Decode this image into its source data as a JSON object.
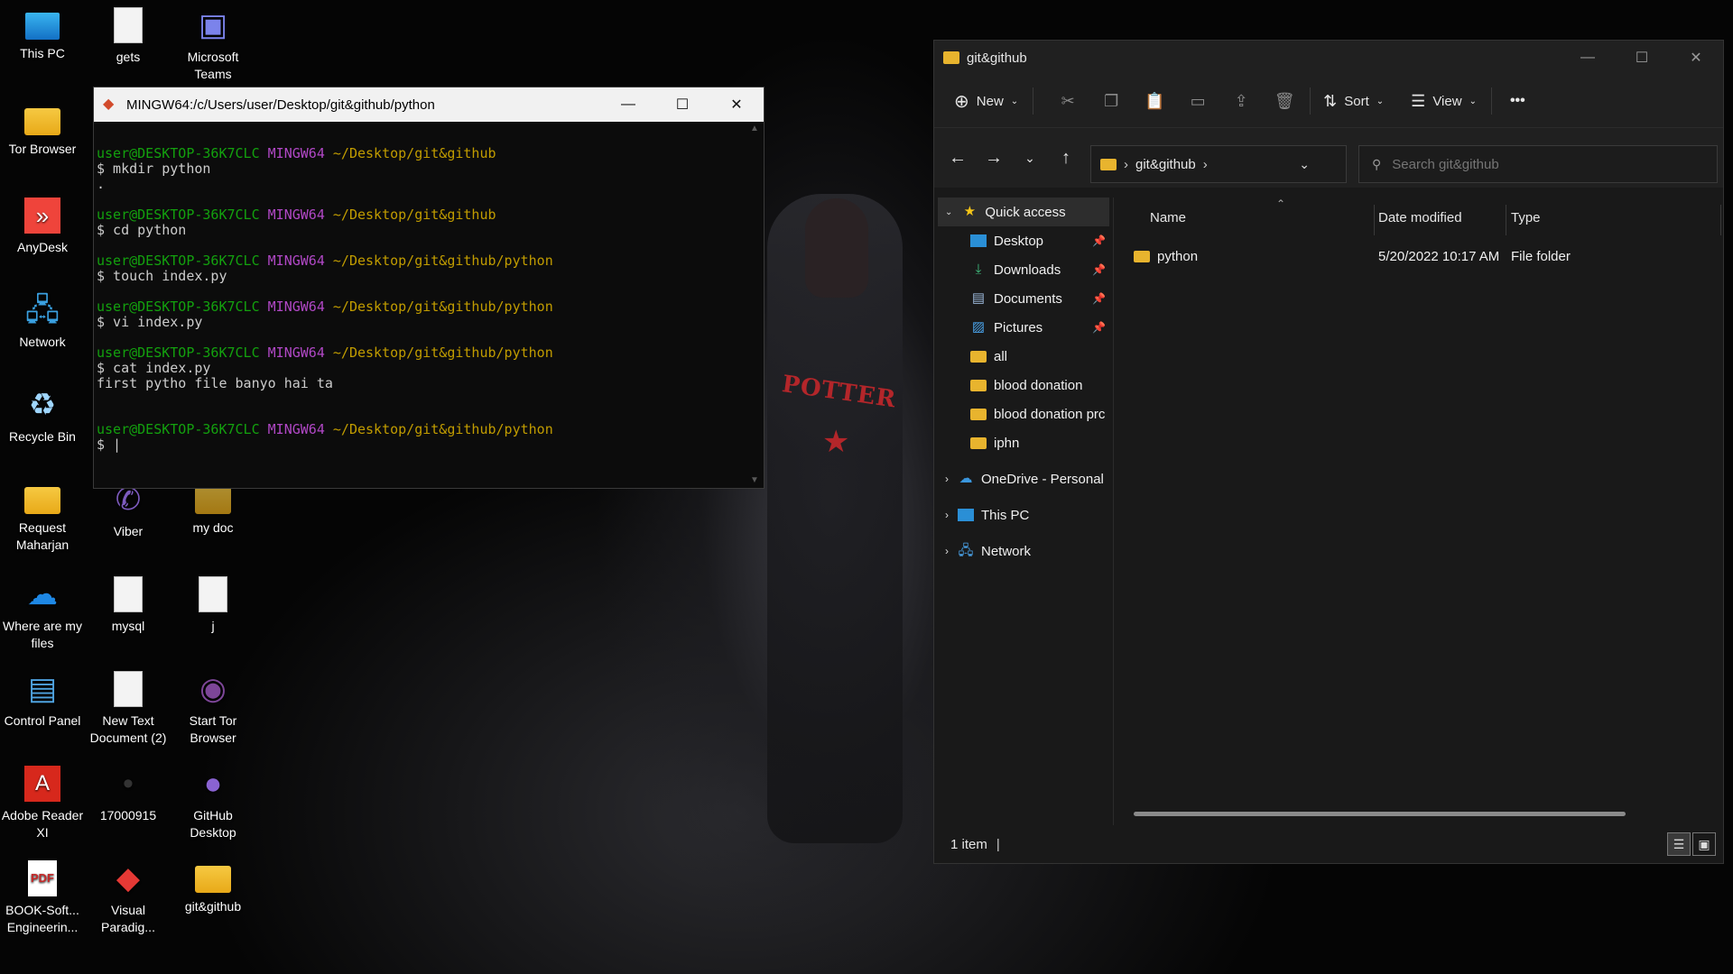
{
  "desktop": {
    "icons": [
      {
        "label": "This PC"
      },
      {
        "label": "gets"
      },
      {
        "label": "Microsoft Teams"
      },
      {
        "label": "Tor Browser"
      },
      {
        "label": "AnyDesk"
      },
      {
        "label": "Network"
      },
      {
        "label": "Recycle Bin"
      },
      {
        "label": "Request Maharjan"
      },
      {
        "label": "Viber"
      },
      {
        "label": "my doc"
      },
      {
        "label": "Where are my files"
      },
      {
        "label": "mysql"
      },
      {
        "label": "j"
      },
      {
        "label": "Control Panel"
      },
      {
        "label": "New Text Document (2)"
      },
      {
        "label": "Start Tor Browser"
      },
      {
        "label": "Adobe Reader XI"
      },
      {
        "label": "17000915"
      },
      {
        "label": "GitHub Desktop"
      },
      {
        "label": "BOOK-Soft... Engineerin..."
      },
      {
        "label": "Visual Paradig..."
      },
      {
        "label": "git&github"
      }
    ],
    "wallpaper_text": "POTTER"
  },
  "terminal": {
    "title": "MINGW64:/c/Users/user/Desktop/git&github/python",
    "prompts": [
      {
        "user": "user@DESKTOP-36K7CLC",
        "sys": "MINGW64",
        "path": "~/Desktop/git&github",
        "command": "$ mkdir python",
        "output": "."
      },
      {
        "user": "user@DESKTOP-36K7CLC",
        "sys": "MINGW64",
        "path": "~/Desktop/git&github",
        "command": "$ cd python",
        "output": ""
      },
      {
        "user": "user@DESKTOP-36K7CLC",
        "sys": "MINGW64",
        "path": "~/Desktop/git&github/python",
        "command": "$ touch index.py",
        "output": ""
      },
      {
        "user": "user@DESKTOP-36K7CLC",
        "sys": "MINGW64",
        "path": "~/Desktop/git&github/python",
        "command": "$ vi index.py",
        "output": ""
      },
      {
        "user": "user@DESKTOP-36K7CLC",
        "sys": "MINGW64",
        "path": "~/Desktop/git&github/python",
        "command": "$ cat index.py",
        "output": "first pytho file banyo hai ta"
      },
      {
        "user": "user@DESKTOP-36K7CLC",
        "sys": "MINGW64",
        "path": "~/Desktop/git&github/python",
        "command": "$ |",
        "output": ""
      }
    ]
  },
  "explorer": {
    "title": "git&github",
    "toolbar": {
      "new_label": "New",
      "sort_label": "Sort",
      "view_label": "View",
      "more_label": "•••"
    },
    "address": {
      "crumb": "git&github"
    },
    "search": {
      "placeholder": "Search git&github"
    },
    "nav_pane": {
      "quick_access": "Quick access",
      "pinned": [
        "Desktop",
        "Downloads",
        "Documents",
        "Pictures"
      ],
      "folders": [
        "all",
        "blood donation",
        "blood donation prc",
        "iphn"
      ],
      "onedrive": "OneDrive - Personal",
      "this_pc": "This PC",
      "network": "Network"
    },
    "columns": {
      "name": "Name",
      "date": "Date modified",
      "type": "Type"
    },
    "files": [
      {
        "name": "python",
        "date": "5/20/2022 10:17 AM",
        "type": "File folder"
      }
    ],
    "status": "1 item"
  }
}
